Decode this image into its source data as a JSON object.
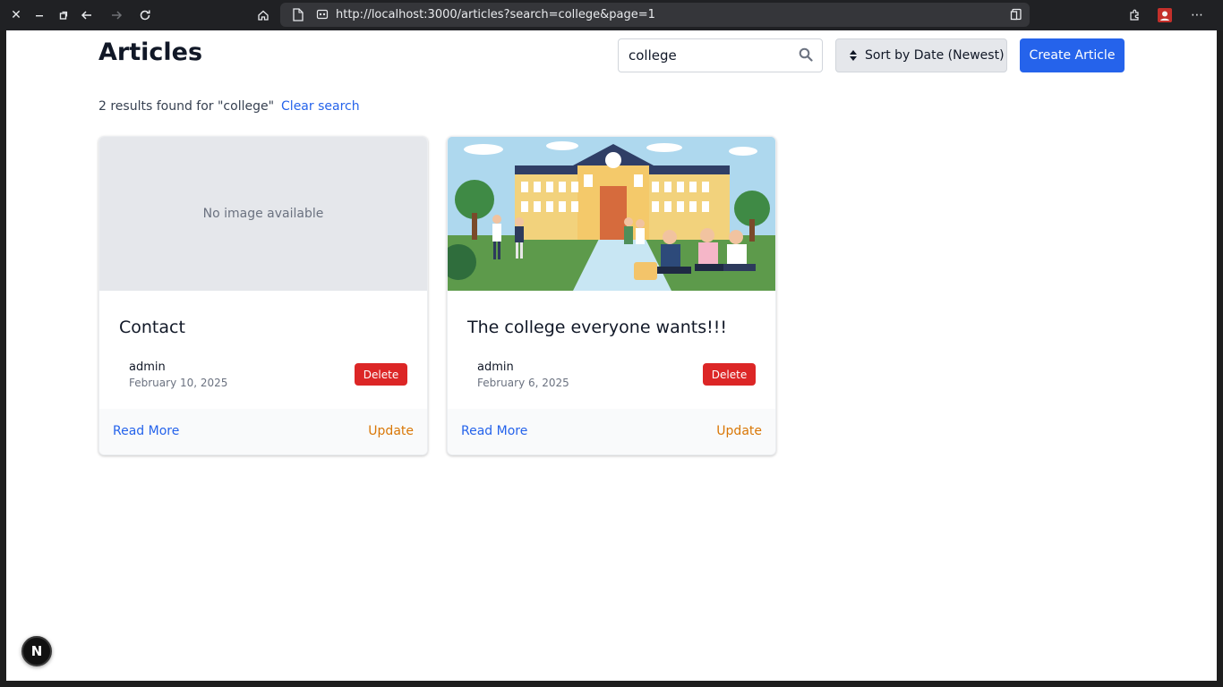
{
  "browser": {
    "url": "http://localhost:3000/articles?search=college&page=1"
  },
  "header": {
    "title": "Articles",
    "search_value": "college",
    "sort_label": "Sort by Date (Newest)",
    "create_label": "Create Article"
  },
  "results": {
    "summary": "2 results found for \"college\"",
    "clear_label": "Clear search"
  },
  "articles": [
    {
      "title": "Contact",
      "image_placeholder": "No image available",
      "author": "admin",
      "date": "February 10, 2025",
      "delete_label": "Delete",
      "read_more_label": "Read More",
      "update_label": "Update"
    },
    {
      "title": "The college everyone wants!!!",
      "author": "admin",
      "date": "February 6, 2025",
      "delete_label": "Delete",
      "read_more_label": "Read More",
      "update_label": "Update"
    }
  ],
  "dev_badge": "N",
  "colors": {
    "primary": "#2563eb",
    "danger": "#dc2626",
    "warning": "#d97706"
  }
}
